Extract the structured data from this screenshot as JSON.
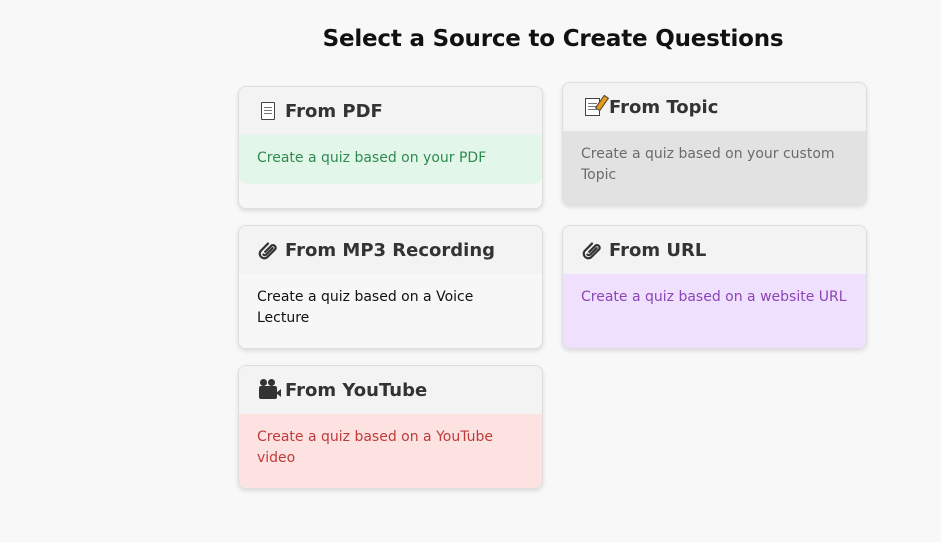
{
  "page": {
    "title": "Select a Source to Create Questions"
  },
  "cards": {
    "pdf": {
      "icon": "document-icon",
      "title": "From PDF",
      "description": "Create a quiz based on your PDF",
      "accent": "#2e8b50",
      "background": "#e3f6ea"
    },
    "topic": {
      "icon": "memo-icon",
      "title": "From Topic",
      "description": "Create a quiz based on your custom Topic",
      "accent": "#6b6b6b",
      "background": "#e2e2e2"
    },
    "mp3": {
      "icon": "paperclip-icon",
      "title": "From MP3 Recording",
      "description": "Create a quiz based on a Voice Lecture",
      "accent": "#111111",
      "background": "#f7f7f7"
    },
    "url": {
      "icon": "paperclip-icon",
      "title": "From URL",
      "description": "Create a quiz based on a website URL",
      "accent": "#8c44b7",
      "background": "#efe0fd"
    },
    "youtube": {
      "icon": "video-camera-icon",
      "title": "From YouTube",
      "description": "Create a quiz based on a YouTube video",
      "accent": "#c03a3a",
      "background": "#fde2e2"
    }
  }
}
